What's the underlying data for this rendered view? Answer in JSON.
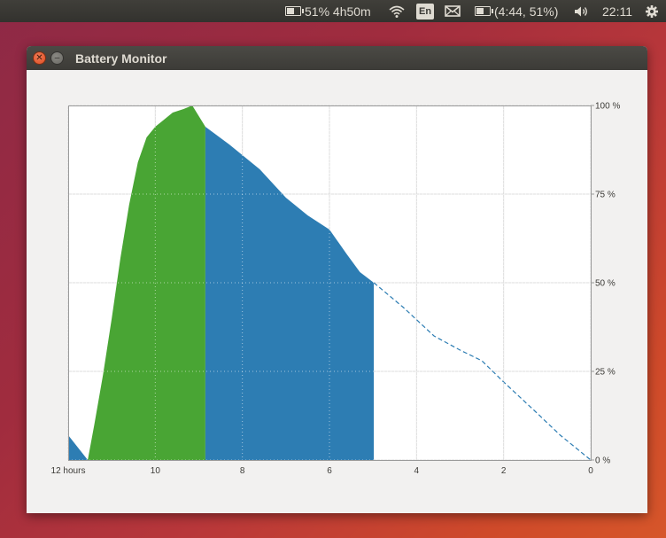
{
  "top_panel": {
    "battery_indicator": "51% 4h50m",
    "keyboard_layout": "En",
    "battery_detail": "(4:44, 51%)",
    "clock": "22:11"
  },
  "window": {
    "title": "Battery Monitor"
  },
  "colors": {
    "charging": "#49a534",
    "discharging": "#2d7db3",
    "projection": "#2d7db3"
  },
  "icons": [
    "battery-icon",
    "wifi-icon",
    "mail-icon",
    "volume-icon",
    "settings-gear-icon",
    "close-icon",
    "minimize-icon"
  ],
  "chart_data": {
    "type": "area",
    "x_axis": {
      "range": [
        12,
        0
      ],
      "ticks": [
        12,
        10,
        8,
        6,
        4,
        2,
        0
      ],
      "tick_labels": [
        "12 hours",
        "10",
        "8",
        "6",
        "4",
        "2",
        "0"
      ]
    },
    "y_axis": {
      "range": [
        0,
        100
      ],
      "position": "right",
      "ticks": [
        0,
        25,
        50,
        75,
        100
      ],
      "tick_labels": [
        "0 %",
        "25 %",
        "50 %",
        "75 %",
        "100 %"
      ]
    },
    "grid": true,
    "series": [
      {
        "state": "discharging",
        "style": "filled",
        "points": [
          [
            12,
            7
          ],
          [
            11.55,
            0
          ]
        ]
      },
      {
        "state": "charging",
        "style": "filled",
        "points": [
          [
            11.55,
            0
          ],
          [
            11.4,
            10
          ],
          [
            11.2,
            24
          ],
          [
            11,
            40
          ],
          [
            10.8,
            57
          ],
          [
            10.6,
            72
          ],
          [
            10.4,
            84
          ],
          [
            10.2,
            91
          ],
          [
            10,
            94
          ],
          [
            9.8,
            96
          ],
          [
            9.6,
            98
          ],
          [
            9.35,
            99
          ],
          [
            9.15,
            100
          ],
          [
            8.85,
            94
          ],
          [
            8.85,
            0
          ]
        ]
      },
      {
        "state": "discharging",
        "style": "filled",
        "points": [
          [
            8.85,
            0
          ],
          [
            8.85,
            94
          ],
          [
            8.3,
            89
          ],
          [
            7.6,
            82
          ],
          [
            7,
            74
          ],
          [
            6.5,
            69
          ],
          [
            6,
            65
          ],
          [
            5.6,
            58
          ],
          [
            5.3,
            53
          ],
          [
            4.98,
            50
          ],
          [
            4.98,
            0
          ]
        ]
      },
      {
        "state": "projection",
        "style": "dashed",
        "points": [
          [
            4.98,
            50
          ],
          [
            4.3,
            43
          ],
          [
            3.6,
            35
          ],
          [
            3,
            31
          ],
          [
            2.5,
            28
          ],
          [
            2,
            22
          ],
          [
            1.3,
            14
          ],
          [
            0.7,
            7
          ],
          [
            0,
            0
          ]
        ]
      }
    ]
  }
}
